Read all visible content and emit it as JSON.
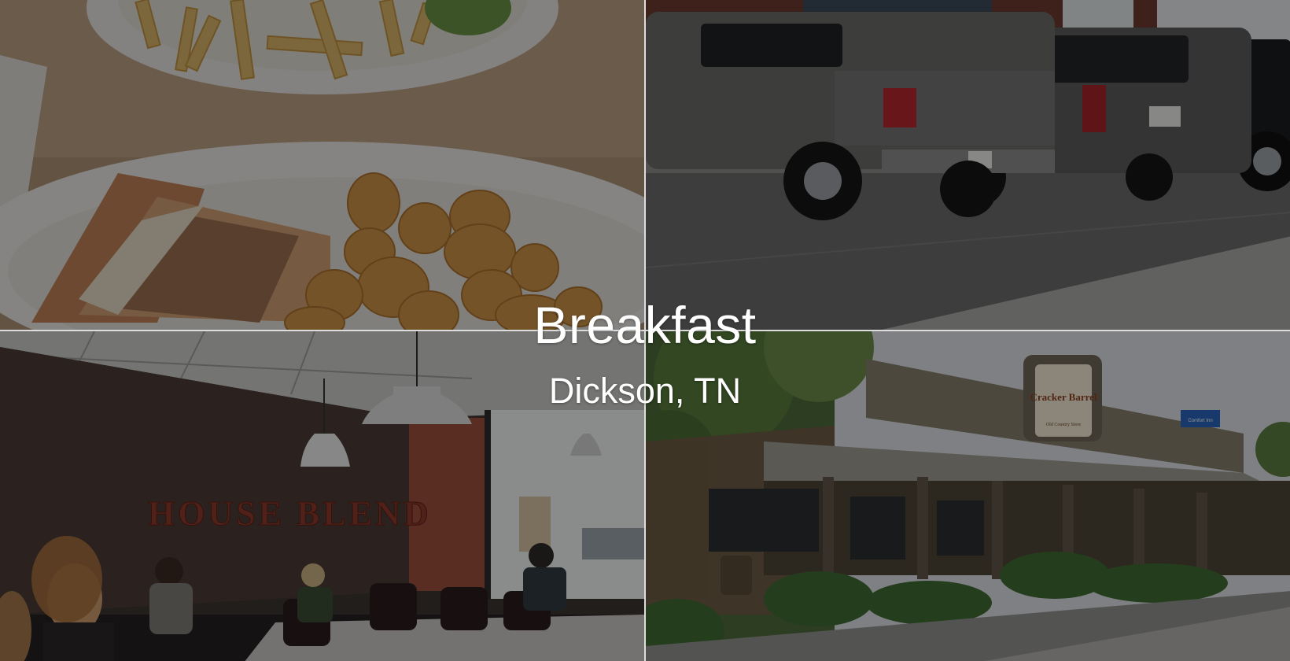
{
  "hero": {
    "title": "Breakfast",
    "subtitle": "Dickson, TN"
  },
  "photos": {
    "top_left": "food-plates-photo",
    "top_right": "parked-trucks-photo",
    "bottom_left": "dining-room-photo",
    "bottom_right": "restaurant-exterior-photo"
  },
  "signs": {
    "wall_sign": "HOUSE BLEND",
    "store_sign": "Cracker Barrel",
    "store_sign_tagline": "Old Country Store",
    "hotel_sign": "Comfort Inn"
  }
}
